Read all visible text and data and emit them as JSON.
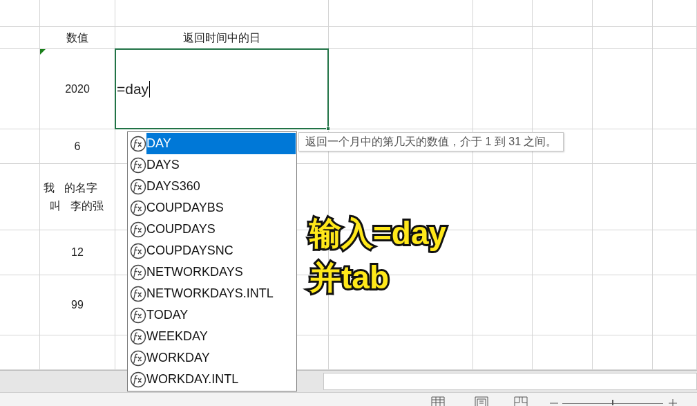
{
  "sheet": {
    "rows": [
      {
        "cells": []
      },
      {
        "cells": [
          {},
          {
            "text": "数值"
          },
          {
            "text": "返回时间中的日"
          }
        ]
      },
      {
        "cells": [
          {},
          {
            "text": "2020",
            "flag": true
          },
          {
            "text": "=day",
            "editing": true
          }
        ]
      },
      {
        "cells": [
          {},
          {
            "text": "6"
          }
        ]
      },
      {
        "cells": [
          {},
          {
            "lines": [
              [
                "我",
                "的名字"
              ],
              [
                "叫",
                "李的强"
              ]
            ]
          }
        ]
      },
      {
        "cells": [
          {},
          {
            "text": "12"
          }
        ]
      },
      {
        "cells": [
          {},
          {
            "text": "99"
          }
        ]
      },
      {
        "cells": []
      }
    ]
  },
  "autocomplete": {
    "items": [
      {
        "label": "DAY",
        "selected": true
      },
      {
        "label": "DAYS",
        "selected": false
      },
      {
        "label": "DAYS360",
        "selected": false
      },
      {
        "label": "COUPDAYBS",
        "selected": false
      },
      {
        "label": "COUPDAYS",
        "selected": false
      },
      {
        "label": "COUPDAYSNC",
        "selected": false
      },
      {
        "label": "NETWORKDAYS",
        "selected": false
      },
      {
        "label": "NETWORKDAYS.INTL",
        "selected": false
      },
      {
        "label": "TODAY",
        "selected": false
      },
      {
        "label": "WEEKDAY",
        "selected": false
      },
      {
        "label": "WORKDAY",
        "selected": false
      },
      {
        "label": "WORKDAY.INTL",
        "selected": false
      }
    ]
  },
  "zoom": {
    "level": 0.5
  },
  "tooltip": "返回一个月中的第几天的数值，介于 1 到 31 之间。",
  "annotation": [
    "输入=day",
    "并tab"
  ]
}
